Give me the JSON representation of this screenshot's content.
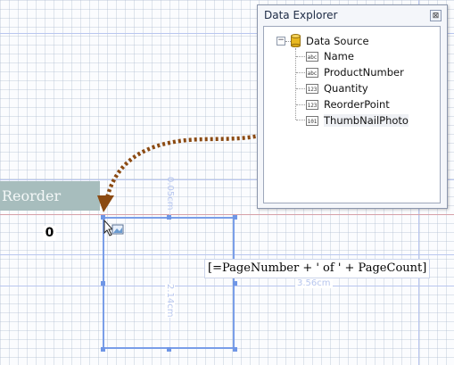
{
  "panel": {
    "title": "Data Explorer",
    "close_glyph": "⊠",
    "expander_glyph": "−",
    "root": {
      "label": "Data Source",
      "icon": "database-icon"
    },
    "fields": [
      {
        "label": "Name",
        "type_icon": "abc"
      },
      {
        "label": "ProductNumber",
        "type_icon": "abc"
      },
      {
        "label": "Quantity",
        "type_icon": "123"
      },
      {
        "label": "ReorderPoint",
        "type_icon": "123"
      },
      {
        "label": "ThumbNailPhoto",
        "type_icon": "101"
      }
    ],
    "selected_field": "ThumbNailPhoto"
  },
  "report": {
    "header_cell_text": "Reorder",
    "zero_value": "0",
    "expression": "[=PageNumber + ' of ' + PageCount]",
    "dim_top": "0.05cm",
    "dim_height": "2.14cm",
    "dim_width": "3.56cm"
  },
  "colors": {
    "drag_arrow": "#8b4a12",
    "selection_border": "#7a9ee8",
    "header_fill": "#a7bdbd",
    "band_line": "#d6a0a8"
  }
}
